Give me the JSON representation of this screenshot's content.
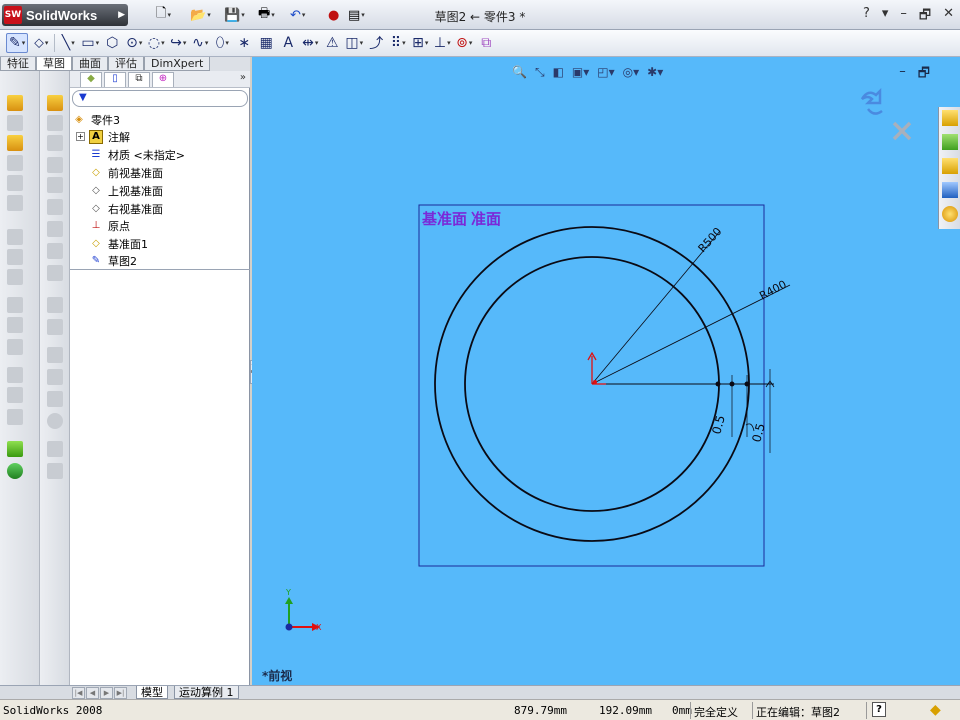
{
  "app": {
    "brand": "SolidWorks",
    "window_title": "草图2 ← 零件3 *",
    "title_controls": [
      "?",
      "▾",
      "–",
      "🗗",
      "✕"
    ]
  },
  "command_tabs": [
    "特征",
    "草图",
    "曲面",
    "评估",
    "DimXpert"
  ],
  "command_tabs_active": "草图",
  "feature_tree": {
    "root": "零件3",
    "items": [
      {
        "label": "注解",
        "icon": "annotation-icon",
        "expandable": true
      },
      {
        "label": "材质 <未指定>",
        "icon": "material-icon",
        "expandable": false
      },
      {
        "label": "前视基准面",
        "icon": "plane-icon",
        "expandable": false
      },
      {
        "label": "上视基准面",
        "icon": "plane-icon",
        "expandable": false
      },
      {
        "label": "右视基准面",
        "icon": "plane-icon",
        "expandable": false
      },
      {
        "label": "原点",
        "icon": "origin-icon",
        "expandable": false
      },
      {
        "label": "基准面1",
        "icon": "plane-icon",
        "expandable": false
      },
      {
        "label": "草图2",
        "icon": "sketch-icon",
        "expandable": false
      }
    ],
    "expand_glyph": "»"
  },
  "graphics": {
    "plane_label": "基准面  准面",
    "view_label": "*前视",
    "dims": {
      "r_outer": "R500",
      "r_inner": "R400",
      "gap1": "0.5",
      "gap2": "0.5"
    },
    "colors": {
      "background": "#56b9fa",
      "sketch": "#0a0a14",
      "plane_label": "#7a2ad8"
    }
  },
  "bottom_tabs": [
    "模型",
    "运动算例 1"
  ],
  "bottom_tab_active": "模型",
  "status": {
    "app_version": "SolidWorks 2008",
    "x": "879.79mm",
    "y": "192.09mm",
    "z": "0mm",
    "state": "完全定义",
    "editing": "正在编辑：草图2",
    "help": "?"
  }
}
